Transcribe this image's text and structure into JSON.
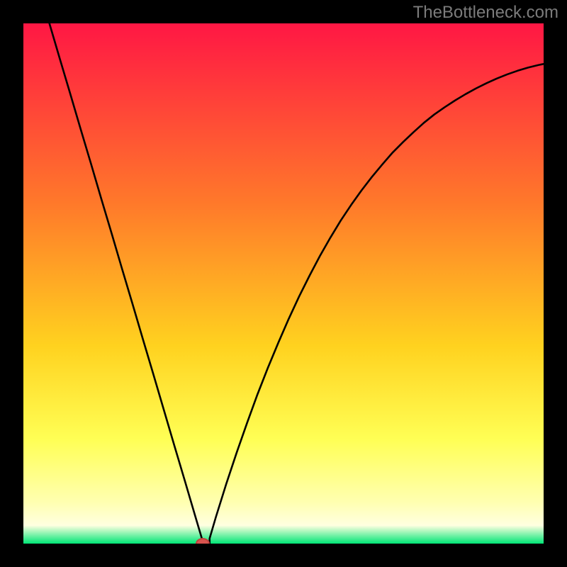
{
  "attribution": "TheBottleneck.com",
  "colors": {
    "top": "#ff1744",
    "upper_mid": "#ff7a2a",
    "mid": "#ffd21f",
    "lower_mid": "#ffff55",
    "pale_yellow": "#ffffb0",
    "green": "#00e676",
    "curve": "#000000",
    "marker_fill": "#d9544f",
    "marker_border": "#c0413c",
    "background": "#000000"
  },
  "chart_data": {
    "type": "line",
    "title": "",
    "xlabel": "",
    "ylabel": "",
    "xlim": [
      0,
      100
    ],
    "ylim": [
      0,
      100
    ],
    "background_gradient": "red-yellow-green vertical",
    "minimum_marker": {
      "x": 34.5,
      "y": 0
    },
    "series": [
      {
        "name": "bottleneck-curve",
        "x_y": [
          [
            5.0,
            100.0
          ],
          [
            7.0,
            93.2
          ],
          [
            9.0,
            86.5
          ],
          [
            11.0,
            79.7
          ],
          [
            13.0,
            73.0
          ],
          [
            15.0,
            66.2
          ],
          [
            17.0,
            59.5
          ],
          [
            19.0,
            52.7
          ],
          [
            21.0,
            46.0
          ],
          [
            23.0,
            39.2
          ],
          [
            25.0,
            32.5
          ],
          [
            27.0,
            25.7
          ],
          [
            29.0,
            18.9
          ],
          [
            31.0,
            12.2
          ],
          [
            33.0,
            5.4
          ],
          [
            34.3,
            1.0
          ],
          [
            34.3,
            0.0
          ],
          [
            35.8,
            0.0
          ],
          [
            35.8,
            1.0
          ],
          [
            37.0,
            5.1
          ],
          [
            39.0,
            11.5
          ],
          [
            41.0,
            17.5
          ],
          [
            43.0,
            23.2
          ],
          [
            45.0,
            28.7
          ],
          [
            47.0,
            33.8
          ],
          [
            49.0,
            38.6
          ],
          [
            51.0,
            43.2
          ],
          [
            53.0,
            47.5
          ],
          [
            55.0,
            51.5
          ],
          [
            57.0,
            55.3
          ],
          [
            59.0,
            58.8
          ],
          [
            61.0,
            62.1
          ],
          [
            63.0,
            65.1
          ],
          [
            65.0,
            67.9
          ],
          [
            67.0,
            70.5
          ],
          [
            69.0,
            72.9
          ],
          [
            71.0,
            75.2
          ],
          [
            73.0,
            77.2
          ],
          [
            75.0,
            79.1
          ],
          [
            77.0,
            80.9
          ],
          [
            79.0,
            82.5
          ],
          [
            81.0,
            83.9
          ],
          [
            83.0,
            85.2
          ],
          [
            85.0,
            86.4
          ],
          [
            87.0,
            87.5
          ],
          [
            89.0,
            88.5
          ],
          [
            91.0,
            89.4
          ],
          [
            93.0,
            90.2
          ],
          [
            95.0,
            90.9
          ],
          [
            97.0,
            91.5
          ],
          [
            99.0,
            92.0
          ],
          [
            100.0,
            92.2
          ]
        ]
      }
    ]
  }
}
